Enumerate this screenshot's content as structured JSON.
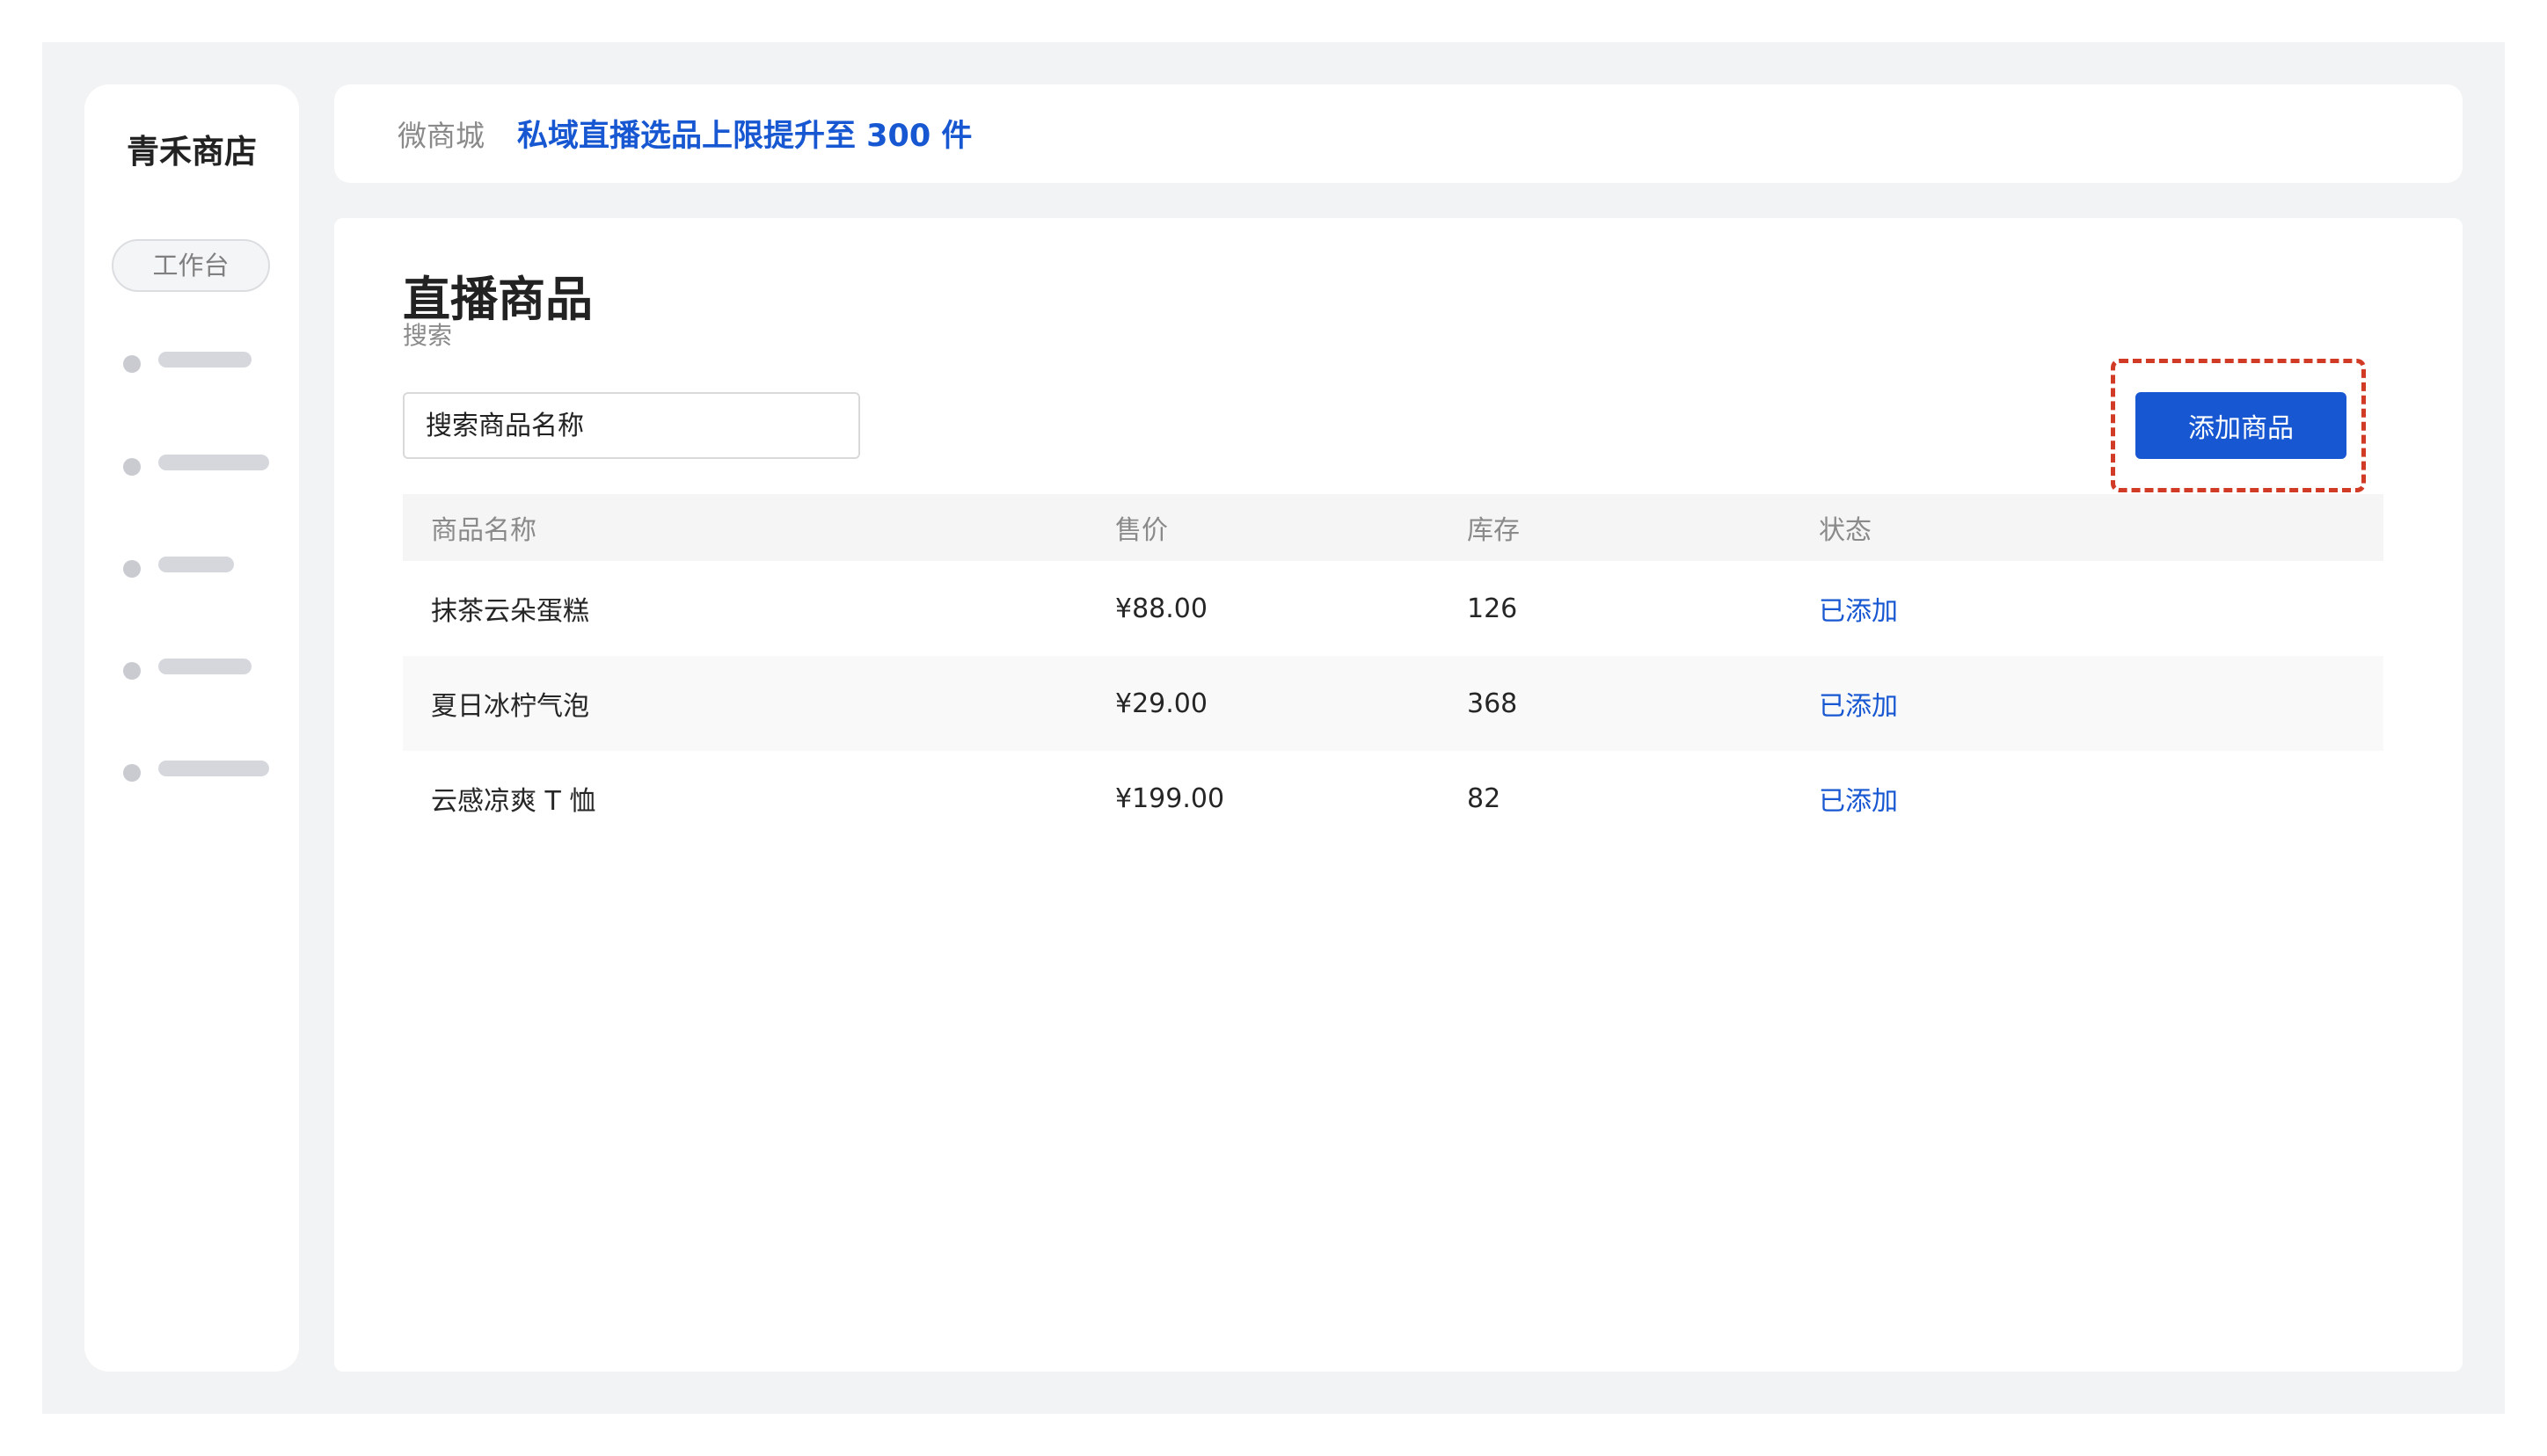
{
  "sidebar": {
    "brand": "青禾商店",
    "workspace_label": "工作台",
    "placeholder_items": 5
  },
  "topbar": {
    "breadcrumb": "微商城",
    "notice": "私域直播选品上限提升至 300 件"
  },
  "main": {
    "title": "直播商品",
    "search_label": "搜索",
    "search_placeholder": "搜索商品名称",
    "add_button_label": "添加商品"
  },
  "table": {
    "columns": [
      "商品名称",
      "售价",
      "库存",
      "状态"
    ],
    "rows": [
      {
        "name": "抹茶云朵蛋糕",
        "price": "¥88.00",
        "stock": "126",
        "status": "已添加"
      },
      {
        "name": "夏日冰柠气泡",
        "price": "¥29.00",
        "stock": "368",
        "status": "已添加"
      },
      {
        "name": "云感凉爽 T 恤",
        "price": "¥199.00",
        "stock": "82",
        "status": "已添加"
      }
    ]
  },
  "colors": {
    "accent": "#1757d1",
    "highlight": "#d13a24",
    "canvas": "#f2f3f5"
  }
}
